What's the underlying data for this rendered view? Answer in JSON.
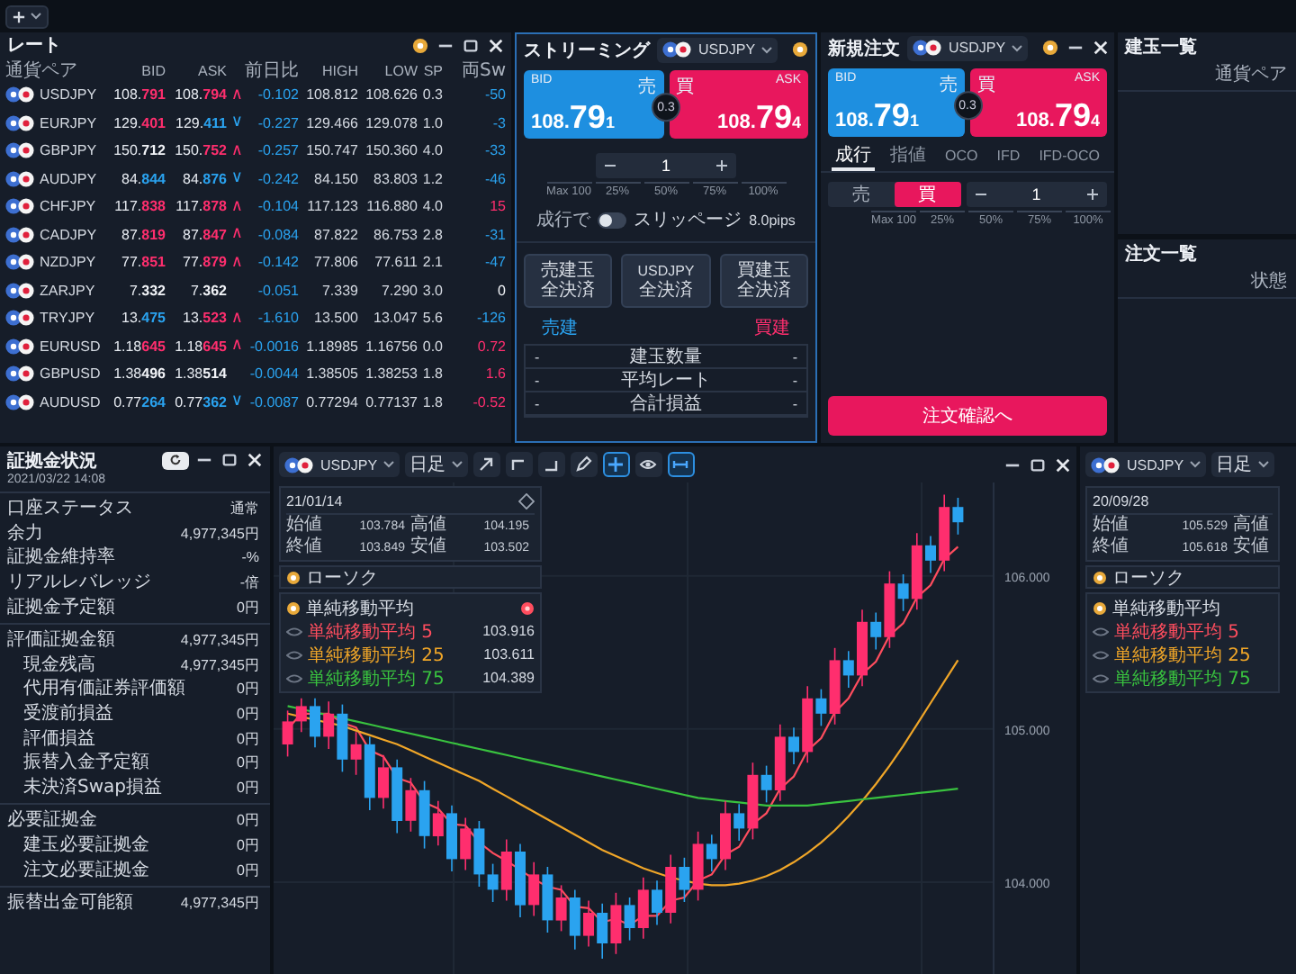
{
  "rates": {
    "title": "レート",
    "columns": [
      "通貨ペア",
      "BID",
      "ASK",
      "前日比",
      "HIGH",
      "LOW",
      "SP",
      "両Sw"
    ],
    "rows": [
      {
        "pair": "USDJPY",
        "bid": {
          "price": "108.791",
          "color": "#ff2e6e"
        },
        "ask": {
          "price": "108.794",
          "color": "#ff2e6e"
        },
        "arrow": {
          "glyph": "∧",
          "color": "#ff2e6e"
        },
        "change": "-0.102",
        "high": "108.812",
        "low": "108.626",
        "sp": "0.3",
        "swap": {
          "value": "-50",
          "color": "#2aa3f0"
        }
      },
      {
        "pair": "EURJPY",
        "bid": {
          "price": "129.401",
          "color": "#ff2e6e"
        },
        "ask": {
          "price": "129.411",
          "color": "#2aa3f0"
        },
        "arrow": {
          "glyph": "∨",
          "color": "#2aa3f0"
        },
        "change": "-0.227",
        "high": "129.466",
        "low": "129.078",
        "sp": "1.0",
        "swap": {
          "value": "-3",
          "color": "#2aa3f0"
        }
      },
      {
        "pair": "GBPJPY",
        "bid": {
          "price": "150.712",
          "color": "#f2f4f8"
        },
        "ask": {
          "price": "150.752",
          "color": "#ff2e6e"
        },
        "arrow": {
          "glyph": "∧",
          "color": "#ff2e6e"
        },
        "change": "-0.257",
        "high": "150.747",
        "low": "150.360",
        "sp": "4.0",
        "swap": {
          "value": "-33",
          "color": "#2aa3f0"
        }
      },
      {
        "pair": "AUDJPY",
        "bid": {
          "price": "84.844",
          "color": "#2aa3f0"
        },
        "ask": {
          "price": "84.876",
          "color": "#2aa3f0"
        },
        "arrow": {
          "glyph": "∨",
          "color": "#2aa3f0"
        },
        "change": "-0.242",
        "high": "84.150",
        "low": "83.803",
        "sp": "1.2",
        "swap": {
          "value": "-46",
          "color": "#2aa3f0"
        }
      },
      {
        "pair": "CHFJPY",
        "bid": {
          "price": "117.838",
          "color": "#ff2e6e"
        },
        "ask": {
          "price": "117.878",
          "color": "#ff2e6e"
        },
        "arrow": {
          "glyph": "∧",
          "color": "#ff2e6e"
        },
        "change": "-0.104",
        "high": "117.123",
        "low": "116.880",
        "sp": "4.0",
        "swap": {
          "value": "15",
          "color": "#ff2e6e"
        }
      },
      {
        "pair": "CADJPY",
        "bid": {
          "price": "87.819",
          "color": "#ff2e6e"
        },
        "ask": {
          "price": "87.847",
          "color": "#ff2e6e"
        },
        "arrow": {
          "glyph": "∧",
          "color": "#ff2e6e"
        },
        "change": "-0.084",
        "high": "87.822",
        "low": "86.753",
        "sp": "2.8",
        "swap": {
          "value": "-31",
          "color": "#2aa3f0"
        }
      },
      {
        "pair": "NZDJPY",
        "bid": {
          "price": "77.851",
          "color": "#ff2e6e"
        },
        "ask": {
          "price": "77.879",
          "color": "#ff2e6e"
        },
        "arrow": {
          "glyph": "∧",
          "color": "#ff2e6e"
        },
        "change": "-0.142",
        "high": "77.806",
        "low": "77.611",
        "sp": "2.1",
        "swap": {
          "value": "-47",
          "color": "#2aa3f0"
        }
      },
      {
        "pair": "ZARJPY",
        "bid": {
          "price": "7.332",
          "color": "#f2f4f8"
        },
        "ask": {
          "price": "7.362",
          "color": "#f2f4f8"
        },
        "change": "-0.051",
        "high": "7.339",
        "low": "7.290",
        "sp": "3.0",
        "swap": {
          "value": "0",
          "color": "#f2f4f8"
        }
      },
      {
        "pair": "TRYJPY",
        "bid": {
          "price": "13.475",
          "color": "#2aa3f0"
        },
        "ask": {
          "price": "13.523",
          "color": "#ff2e6e"
        },
        "arrow": {
          "glyph": "∧",
          "color": "#ff2e6e"
        },
        "change": "-1.610",
        "high": "13.500",
        "low": "13.047",
        "sp": "5.6",
        "swap": {
          "value": "-126",
          "color": "#2aa3f0"
        }
      },
      {
        "pair": "EURUSD",
        "bid": {
          "price": "1.18645",
          "color": "#ff2e6e"
        },
        "ask": {
          "price": "1.18645",
          "color": "#ff2e6e"
        },
        "arrow": {
          "glyph": "∧",
          "color": "#ff2e6e"
        },
        "change": "-0.0016",
        "high": "1.18985",
        "low": "1.16756",
        "sp": "0.0",
        "swap": {
          "value": "0.72",
          "color": "#ff2e6e"
        }
      },
      {
        "pair": "GBPUSD",
        "bid": {
          "price": "1.38496",
          "color": "#f2f4f8"
        },
        "ask": {
          "price": "1.38514",
          "color": "#f2f4f8"
        },
        "change": "-0.0044",
        "high": "1.38505",
        "low": "1.38253",
        "sp": "1.8",
        "swap": {
          "value": "1.6",
          "color": "#ff2e6e"
        }
      },
      {
        "pair": "AUDUSD",
        "bid": {
          "price": "0.77264",
          "color": "#2aa3f0"
        },
        "ask": {
          "price": "0.77362",
          "color": "#2aa3f0"
        },
        "arrow": {
          "glyph": "∨",
          "color": "#2aa3f0"
        },
        "change": "-0.0087",
        "high": "0.77294",
        "low": "0.77137",
        "sp": "1.8",
        "swap": {
          "value": "-0.52",
          "color": "#ff2e6e"
        }
      }
    ]
  },
  "streaming": {
    "title": "ストリーミング",
    "pair": "USDJPY",
    "bid": {
      "label": "BID",
      "side": "売",
      "base": "108.",
      "big": "79",
      "small": "1"
    },
    "ask": {
      "label": "ASK",
      "side": "買",
      "base": "108.",
      "big": "79",
      "small": "4"
    },
    "spread": "0.3",
    "quantity": "1",
    "percents": [
      "Max 100",
      "25%",
      "50%",
      "75%",
      "100%"
    ],
    "market_toggle": {
      "label": "成行で",
      "on": false
    },
    "slippage": "スリッページ",
    "slippage_value": "8.0pips",
    "close_buttons": [
      [
        "売建玉",
        "全決済"
      ],
      [
        "USDJPY",
        "全決済"
      ],
      [
        "買建玉",
        "全決済"
      ]
    ],
    "sell_label": "売建",
    "buy_label": "買建",
    "summary": [
      {
        "sell": "-",
        "label": "建玉数量",
        "buy": "-"
      },
      {
        "sell": "-",
        "label": "平均レート",
        "buy": "-"
      },
      {
        "sell": "-",
        "label": "合計損益",
        "buy": "-"
      }
    ]
  },
  "new_order": {
    "title": "新規注文",
    "pair": "USDJPY",
    "bid": {
      "label": "BID",
      "side": "売",
      "base": "108.",
      "big": "79",
      "small": "1"
    },
    "ask": {
      "label": "ASK",
      "side": "買",
      "base": "108.",
      "big": "79",
      "small": "4"
    },
    "spread": "0.3",
    "tabs": [
      {
        "label": "成行",
        "selected": true
      },
      {
        "label": "指値",
        "selected": false
      },
      {
        "label": "OCO",
        "selected": false
      },
      {
        "label": "IFD",
        "selected": false
      },
      {
        "label": "IFD-OCO",
        "selected": false
      }
    ],
    "sides": [
      {
        "label": "売",
        "selected": false
      },
      {
        "label": "買",
        "selected": true
      }
    ],
    "quantity": "1",
    "percents": [
      "Max 100",
      "25%",
      "50%",
      "75%",
      "100%"
    ],
    "confirm": "注文確認へ"
  },
  "positions": {
    "title": "建玉一覧",
    "column": "通貨ペア"
  },
  "orders": {
    "title": "注文一覧",
    "column": "状態"
  },
  "account": {
    "title": "証拠金状況",
    "timestamp": "2021/03/22 14:08",
    "groups": [
      [
        {
          "label": "口座ステータス",
          "value": "通常"
        },
        {
          "label": "余力",
          "value": "4,977,345円"
        },
        {
          "label": "証拠金維持率",
          "value": "-%"
        },
        {
          "label": "リアルレバレッジ",
          "value": "-倍"
        },
        {
          "label": "証拠金予定額",
          "value": "0円"
        }
      ],
      [
        {
          "label": "評価証拠金額",
          "value": "4,977,345円",
          "children": [
            {
              "label": "現金残高",
              "value": "4,977,345円"
            },
            {
              "label": "代用有価証券評価額",
              "value": "0円"
            },
            {
              "label": "受渡前損益",
              "value": "0円"
            },
            {
              "label": "評価損益",
              "value": "0円"
            },
            {
              "label": "振替入金予定額",
              "value": "0円"
            },
            {
              "label": "未決済Swap損益",
              "value": "0円"
            }
          ]
        }
      ],
      [
        {
          "label": "必要証拠金",
          "value": "0円",
          "children": [
            {
              "label": "建玉必要証拠金",
              "value": "0円"
            },
            {
              "label": "注文必要証拠金",
              "value": "0円"
            }
          ]
        }
      ],
      [
        {
          "label": "振替出金可能額",
          "value": "4,977,345円"
        }
      ]
    ]
  },
  "chart": {
    "pair": "USDJPY",
    "period": "日足",
    "tools": [
      {
        "kind": "arrow",
        "selected": false
      },
      {
        "kind": "step-up",
        "selected": false
      },
      {
        "kind": "step-down",
        "selected": false
      },
      {
        "kind": "pen",
        "selected": false
      },
      {
        "kind": "crosshair",
        "selected": true
      },
      {
        "kind": "eye",
        "selected": false
      },
      {
        "kind": "range",
        "selected": true
      }
    ],
    "info": {
      "date": "21/01/14",
      "rows": [
        [
          "始値",
          "103.784",
          "高値",
          "104.195"
        ],
        [
          "終値",
          "103.849",
          "安値",
          "103.502"
        ]
      ]
    },
    "candle_label": "ローソク",
    "indicator": "単純移動平均",
    "lines": [
      {
        "value": "103.916"
      },
      {
        "value": "103.611"
      },
      {
        "value": "104.389"
      }
    ],
    "chart_data": {
      "type": "candlestick",
      "grid": true,
      "ylim": [
        103.4,
        106.61
      ],
      "yticks": [
        {
          "value": 104,
          "label": "104.000"
        },
        {
          "value": 105,
          "label": "105.000"
        },
        {
          "value": 106,
          "label": "106.000"
        }
      ],
      "ohlc": [
        [
          104.9,
          105.12,
          104.82,
          105.05
        ],
        [
          105.05,
          105.2,
          104.98,
          105.15
        ],
        [
          105.15,
          105.2,
          104.88,
          104.95
        ],
        [
          104.95,
          105.18,
          104.87,
          105.1
        ],
        [
          105.1,
          105.16,
          104.72,
          104.8
        ],
        [
          104.8,
          104.98,
          104.7,
          104.9
        ],
        [
          104.9,
          104.95,
          104.47,
          104.55
        ],
        [
          104.55,
          104.83,
          104.48,
          104.75
        ],
        [
          104.75,
          104.8,
          104.32,
          104.4
        ],
        [
          104.4,
          104.68,
          104.33,
          104.6
        ],
        [
          104.6,
          104.66,
          104.22,
          104.3
        ],
        [
          104.3,
          104.53,
          104.24,
          104.45
        ],
        [
          104.45,
          104.5,
          104.07,
          104.15
        ],
        [
          104.15,
          104.42,
          104.08,
          104.35
        ],
        [
          104.35,
          104.4,
          103.97,
          104.05
        ],
        [
          104.05,
          104.12,
          103.87,
          103.95
        ],
        [
          103.95,
          104.28,
          103.88,
          104.2
        ],
        [
          104.2,
          104.25,
          103.77,
          103.85
        ],
        [
          103.85,
          104.13,
          103.78,
          104.05
        ],
        [
          104.05,
          104.1,
          103.67,
          103.75
        ],
        [
          103.75,
          103.98,
          103.68,
          103.9
        ],
        [
          103.9,
          103.95,
          103.56,
          103.65
        ],
        [
          103.65,
          103.88,
          103.58,
          103.8
        ],
        [
          103.8,
          103.86,
          103.5,
          103.6
        ],
        [
          103.6,
          103.93,
          103.53,
          103.85
        ],
        [
          103.85,
          103.9,
          103.62,
          103.7
        ],
        [
          103.7,
          104.03,
          103.63,
          103.95
        ],
        [
          103.95,
          104.01,
          103.72,
          103.8
        ],
        [
          103.8,
          104.18,
          103.73,
          104.1
        ],
        [
          104.1,
          104.16,
          103.87,
          103.95
        ],
        [
          103.95,
          104.33,
          103.88,
          104.25
        ],
        [
          104.25,
          104.31,
          104.07,
          104.15
        ],
        [
          104.15,
          104.53,
          104.08,
          104.45
        ],
        [
          104.45,
          104.51,
          104.27,
          104.35
        ],
        [
          104.35,
          104.78,
          104.28,
          104.7
        ],
        [
          104.7,
          104.76,
          104.52,
          104.6
        ],
        [
          104.6,
          105.03,
          104.53,
          104.95
        ],
        [
          104.95,
          105.01,
          104.77,
          104.85
        ],
        [
          104.85,
          105.28,
          104.78,
          105.2
        ],
        [
          105.2,
          105.26,
          105.02,
          105.1
        ],
        [
          105.1,
          105.53,
          105.03,
          105.45
        ],
        [
          105.45,
          105.51,
          105.27,
          105.35
        ],
        [
          105.35,
          105.78,
          105.28,
          105.7
        ],
        [
          105.7,
          105.76,
          105.52,
          105.6
        ],
        [
          105.6,
          106.03,
          105.53,
          105.95
        ],
        [
          105.95,
          106.01,
          105.77,
          105.85
        ],
        [
          105.85,
          106.28,
          105.78,
          106.2
        ],
        [
          106.2,
          106.26,
          106.02,
          106.1
        ],
        [
          106.1,
          106.53,
          106.03,
          106.45
        ],
        [
          106.45,
          106.51,
          106.27,
          106.35
        ]
      ],
      "series": [
        {
          "name": "単純移動平均 5",
          "type": "line",
          "color": "#ff4d5e",
          "values": [
            105.0,
            105.1,
            105.1,
            105.1,
            105.04,
            105.01,
            104.86,
            104.82,
            104.68,
            104.65,
            104.52,
            104.48,
            104.38,
            104.37,
            104.26,
            104.19,
            104.14,
            104.08,
            104.02,
            103.97,
            103.95,
            103.84,
            103.83,
            103.74,
            103.76,
            103.72,
            103.78,
            103.78,
            103.88,
            103.9,
            104.01,
            104.05,
            104.18,
            104.23,
            104.38,
            104.45,
            104.61,
            104.69,
            104.86,
            104.94,
            105.11,
            105.2,
            105.36,
            105.44,
            105.61,
            105.69,
            105.86,
            105.94,
            106.11,
            106.19
          ]
        },
        {
          "name": "単純移動平均 25",
          "type": "line",
          "color": "#f0a628",
          "values": [
            105.1,
            105.08,
            105.06,
            105.04,
            105.02,
            104.99,
            104.96,
            104.93,
            104.9,
            104.86,
            104.82,
            104.78,
            104.74,
            104.7,
            104.66,
            104.61,
            104.56,
            104.51,
            104.46,
            104.41,
            104.36,
            104.31,
            104.26,
            104.21,
            104.17,
            104.13,
            104.09,
            104.06,
            104.03,
            104.01,
            103.99,
            103.98,
            103.98,
            103.99,
            104.01,
            104.04,
            104.08,
            104.13,
            104.19,
            104.26,
            104.34,
            104.43,
            104.53,
            104.64,
            104.76,
            104.89,
            105.03,
            105.17,
            105.31,
            105.45
          ]
        },
        {
          "name": "単純移動平均 75",
          "type": "line",
          "color": "#39c23f",
          "values": [
            105.15,
            105.13,
            105.11,
            105.09,
            105.07,
            105.05,
            105.03,
            105.01,
            104.99,
            104.97,
            104.95,
            104.93,
            104.91,
            104.89,
            104.87,
            104.85,
            104.83,
            104.81,
            104.79,
            104.77,
            104.75,
            104.73,
            104.71,
            104.69,
            104.67,
            104.65,
            104.63,
            104.61,
            104.59,
            104.57,
            104.55,
            104.54,
            104.53,
            104.52,
            104.51,
            104.5,
            104.5,
            104.5,
            104.5,
            104.51,
            104.52,
            104.53,
            104.54,
            104.55,
            104.56,
            104.57,
            104.58,
            104.59,
            104.6,
            104.61
          ]
        }
      ]
    }
  },
  "chart_2": {
    "pair": "USDJPY",
    "period": "日足",
    "info": {
      "date": "20/09/28",
      "rows": [
        [
          "始値",
          "105.529",
          "高値"
        ],
        [
          "終値",
          "105.618",
          "安値"
        ]
      ]
    },
    "candle_label": "ローソク",
    "indicator": "単純移動平均",
    "lines": [
      {
        "label": "単純移動平均 5",
        "color": "#ff4d5e"
      },
      {
        "label": "単純移動平均 25",
        "color": "#f0a628"
      },
      {
        "label": "単純移動平均 75",
        "color": "#39c23f"
      }
    ]
  }
}
